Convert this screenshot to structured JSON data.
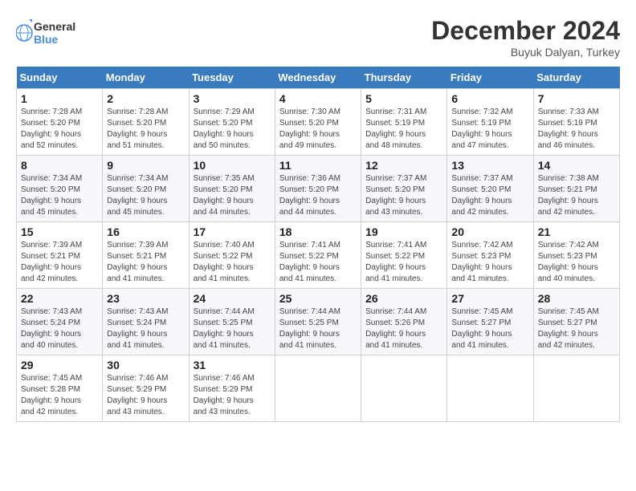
{
  "logo": {
    "line1": "General",
    "line2": "Blue"
  },
  "title": "December 2024",
  "location": "Buyuk Dalyan, Turkey",
  "days_of_week": [
    "Sunday",
    "Monday",
    "Tuesday",
    "Wednesday",
    "Thursday",
    "Friday",
    "Saturday"
  ],
  "weeks": [
    [
      {
        "day": "1",
        "sunrise": "7:28 AM",
        "sunset": "5:20 PM",
        "daylight": "9 hours and 52 minutes."
      },
      {
        "day": "2",
        "sunrise": "7:28 AM",
        "sunset": "5:20 PM",
        "daylight": "9 hours and 51 minutes."
      },
      {
        "day": "3",
        "sunrise": "7:29 AM",
        "sunset": "5:20 PM",
        "daylight": "9 hours and 50 minutes."
      },
      {
        "day": "4",
        "sunrise": "7:30 AM",
        "sunset": "5:20 PM",
        "daylight": "9 hours and 49 minutes."
      },
      {
        "day": "5",
        "sunrise": "7:31 AM",
        "sunset": "5:19 PM",
        "daylight": "9 hours and 48 minutes."
      },
      {
        "day": "6",
        "sunrise": "7:32 AM",
        "sunset": "5:19 PM",
        "daylight": "9 hours and 47 minutes."
      },
      {
        "day": "7",
        "sunrise": "7:33 AM",
        "sunset": "5:19 PM",
        "daylight": "9 hours and 46 minutes."
      }
    ],
    [
      {
        "day": "8",
        "sunrise": "7:34 AM",
        "sunset": "5:20 PM",
        "daylight": "9 hours and 45 minutes."
      },
      {
        "day": "9",
        "sunrise": "7:34 AM",
        "sunset": "5:20 PM",
        "daylight": "9 hours and 45 minutes."
      },
      {
        "day": "10",
        "sunrise": "7:35 AM",
        "sunset": "5:20 PM",
        "daylight": "9 hours and 44 minutes."
      },
      {
        "day": "11",
        "sunrise": "7:36 AM",
        "sunset": "5:20 PM",
        "daylight": "9 hours and 44 minutes."
      },
      {
        "day": "12",
        "sunrise": "7:37 AM",
        "sunset": "5:20 PM",
        "daylight": "9 hours and 43 minutes."
      },
      {
        "day": "13",
        "sunrise": "7:37 AM",
        "sunset": "5:20 PM",
        "daylight": "9 hours and 42 minutes."
      },
      {
        "day": "14",
        "sunrise": "7:38 AM",
        "sunset": "5:21 PM",
        "daylight": "9 hours and 42 minutes."
      }
    ],
    [
      {
        "day": "15",
        "sunrise": "7:39 AM",
        "sunset": "5:21 PM",
        "daylight": "9 hours and 42 minutes."
      },
      {
        "day": "16",
        "sunrise": "7:39 AM",
        "sunset": "5:21 PM",
        "daylight": "9 hours and 41 minutes."
      },
      {
        "day": "17",
        "sunrise": "7:40 AM",
        "sunset": "5:22 PM",
        "daylight": "9 hours and 41 minutes."
      },
      {
        "day": "18",
        "sunrise": "7:41 AM",
        "sunset": "5:22 PM",
        "daylight": "9 hours and 41 minutes."
      },
      {
        "day": "19",
        "sunrise": "7:41 AM",
        "sunset": "5:22 PM",
        "daylight": "9 hours and 41 minutes."
      },
      {
        "day": "20",
        "sunrise": "7:42 AM",
        "sunset": "5:23 PM",
        "daylight": "9 hours and 41 minutes."
      },
      {
        "day": "21",
        "sunrise": "7:42 AM",
        "sunset": "5:23 PM",
        "daylight": "9 hours and 40 minutes."
      }
    ],
    [
      {
        "day": "22",
        "sunrise": "7:43 AM",
        "sunset": "5:24 PM",
        "daylight": "9 hours and 40 minutes."
      },
      {
        "day": "23",
        "sunrise": "7:43 AM",
        "sunset": "5:24 PM",
        "daylight": "9 hours and 41 minutes."
      },
      {
        "day": "24",
        "sunrise": "7:44 AM",
        "sunset": "5:25 PM",
        "daylight": "9 hours and 41 minutes."
      },
      {
        "day": "25",
        "sunrise": "7:44 AM",
        "sunset": "5:25 PM",
        "daylight": "9 hours and 41 minutes."
      },
      {
        "day": "26",
        "sunrise": "7:44 AM",
        "sunset": "5:26 PM",
        "daylight": "9 hours and 41 minutes."
      },
      {
        "day": "27",
        "sunrise": "7:45 AM",
        "sunset": "5:27 PM",
        "daylight": "9 hours and 41 minutes."
      },
      {
        "day": "28",
        "sunrise": "7:45 AM",
        "sunset": "5:27 PM",
        "daylight": "9 hours and 42 minutes."
      }
    ],
    [
      {
        "day": "29",
        "sunrise": "7:45 AM",
        "sunset": "5:28 PM",
        "daylight": "9 hours and 42 minutes."
      },
      {
        "day": "30",
        "sunrise": "7:46 AM",
        "sunset": "5:29 PM",
        "daylight": "9 hours and 43 minutes."
      },
      {
        "day": "31",
        "sunrise": "7:46 AM",
        "sunset": "5:29 PM",
        "daylight": "9 hours and 43 minutes."
      },
      null,
      null,
      null,
      null
    ]
  ],
  "labels": {
    "sunrise": "Sunrise:",
    "sunset": "Sunset:",
    "daylight": "Daylight:"
  }
}
